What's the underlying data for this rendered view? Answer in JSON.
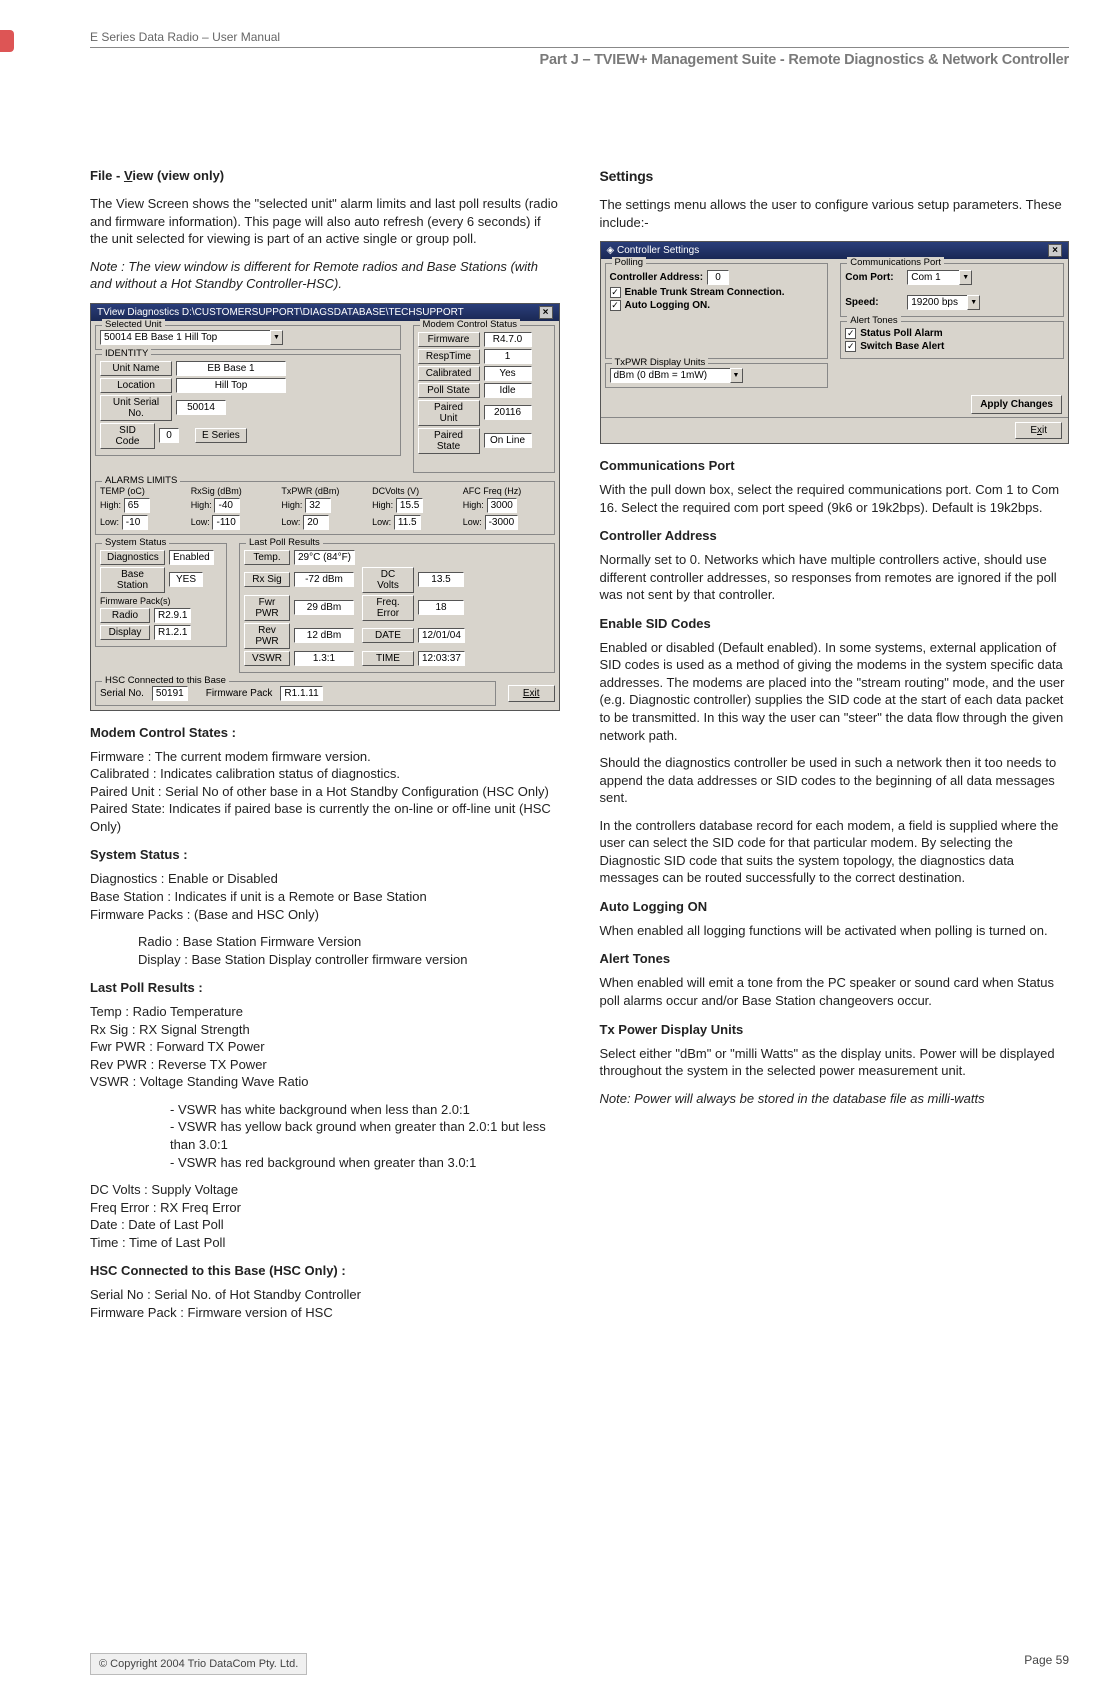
{
  "header": {
    "top": "E Series Data Radio – User Manual",
    "sub": "Part J – TVIEW+ Management Suite -  Remote Diagnostics & Network Controller"
  },
  "footer": {
    "copyright": "© Copyright 2004 Trio DataCom Pty. Ltd.",
    "page": "Page 59"
  },
  "col1": {
    "h1": "File - View (view only)",
    "p1": "The View Screen shows the \"selected unit\" alarm limits and last poll results (radio and firmware information). This page will also auto refresh (every 6 seconds) if the unit selected for viewing is part of an active single or group poll.",
    "note1": "Note : The view window is different for Remote radios and Base Stations (with and without a Hot Standby Controller-HSC).",
    "win1": {
      "title": "TView Diagnostics    D:\\CUSTOMERSUPPORT\\DIAGSDATABASE\\TECHSUPPORT",
      "selected_unit": {
        "label": "Selected Unit",
        "value": "50014 EB Base 1 Hill Top"
      },
      "identity": {
        "label": "IDENTITY",
        "unit_name_label": "Unit Name",
        "unit_name": "EB Base 1",
        "location_label": "Location",
        "location": "Hill Top",
        "serial_label": "Unit Serial No.",
        "serial": "50014",
        "sid_label": "SID Code",
        "sid": "0",
        "series_btn": "E Series"
      },
      "mcs": {
        "label": "Modem Control Status",
        "rows": [
          [
            "Firmware",
            "R4.7.0"
          ],
          [
            "RespTime",
            "1"
          ],
          [
            "Calibrated",
            "Yes"
          ],
          [
            "Poll State",
            "Idle"
          ],
          [
            "Paired Unit",
            "20116"
          ],
          [
            "Paired State",
            "On Line"
          ]
        ]
      },
      "alarms": {
        "label": "ALARMS LIMITS",
        "cols": [
          "TEMP (oC)",
          "RxSig (dBm)",
          "TxPWR (dBm)",
          "DCVolts (V)",
          "AFC Freq (Hz)"
        ],
        "high_label": "High:",
        "low_label": "Low:",
        "high": [
          "65",
          "-40",
          "32",
          "15.5",
          "3000"
        ],
        "low": [
          "-10",
          "-110",
          "20",
          "11.5",
          "-3000"
        ]
      },
      "sys": {
        "label": "System Status",
        "diag_label": "Diagnostics",
        "diag": "Enabled",
        "base_label": "Base Station",
        "base": "YES",
        "fw_label": "Firmware Pack(s)",
        "radio_label": "Radio",
        "radio": "R2.9.1",
        "disp_label": "Display",
        "disp": "R1.2.1"
      },
      "lpr": {
        "label": "Last Poll Results",
        "rows": [
          [
            "Temp.",
            "29°C   (84°F)",
            "",
            ""
          ],
          [
            "Rx Sig",
            "-72 dBm",
            "DC Volts",
            "13.5"
          ],
          [
            "Fwr PWR",
            "29 dBm",
            "Freq. Error",
            "18"
          ],
          [
            "Rev PWR",
            "12 dBm",
            "DATE",
            "12/01/04"
          ],
          [
            "VSWR",
            "1.3:1",
            "TIME",
            "12:03:37"
          ]
        ]
      },
      "hsc": {
        "label": "HSC Connected to this Base",
        "serial_label": "Serial No.",
        "serial": "50191",
        "fw_label": "Firmware Pack",
        "fw": "R1.1.11"
      },
      "exit": "Exit"
    },
    "h2": "Modem Control States :",
    "mcs_lines": [
      "Firmware : The current modem firmware version.",
      "Calibrated : Indicates calibration status of diagnostics.",
      "Paired Unit : Serial No of other base in a Hot Standby Configuration (HSC Only)",
      "Paired State: Indicates if paired base is currently the on-line or off-line unit (HSC Only)"
    ],
    "h3": "System Status :",
    "sys_lines": [
      "Diagnostics : Enable or Disabled",
      "Base Station : Indicates if unit is a Remote or Base Station",
      "Firmware Packs : (Base and HSC Only)"
    ],
    "sys_indent": [
      "Radio : Base Station Firmware Version",
      "Display : Base Station Display controller firmware version"
    ],
    "h4": "Last Poll Results :",
    "lpr_lines": [
      "Temp : Radio Temperature",
      "Rx Sig : RX Signal Strength",
      "Fwr PWR : Forward TX Power",
      "Rev PWR : Reverse TX Power",
      "VSWR : Voltage Standing Wave Ratio"
    ],
    "lpr_indent": [
      "- VSWR has white background when less than 2.0:1",
      "- VSWR has yellow back ground when greater than 2.0:1 but   less than 3.0:1",
      "- VSWR has red background when greater than 3.0:1"
    ],
    "lpr_lines2": [
      "DC Volts : Supply Voltage",
      "Freq Error : RX Freq Error",
      "Date : Date of Last Poll",
      "Time : Time of Last Poll"
    ],
    "h5": "HSC Connected to this Base (HSC Only) :",
    "hsc_lines": [
      "Serial No : Serial No. of Hot Standby Controller",
      "Firmware Pack : Firmware version of HSC"
    ]
  },
  "col2": {
    "h1": "Settings",
    "p1": "The settings menu allows the user to configure various setup parameters.  These include:-",
    "win2": {
      "title": "Controller Settings",
      "polling": {
        "label": "Polling",
        "addr_label": "Controller Address:",
        "addr": "0",
        "en_trunk": "Enable Trunk Stream Connection.",
        "auto_log": "Auto Logging ON."
      },
      "comm": {
        "label": "Communications Port",
        "port_label": "Com Port:",
        "port": "Com 1",
        "speed_label": "Speed:",
        "speed": "19200 bps"
      },
      "txp": {
        "label": "TxPWR Display Units",
        "value": "dBm (0 dBm = 1mW)"
      },
      "alert": {
        "label": "Alert Tones",
        "status": "Status Poll Alarm",
        "switch": "Switch Base Alert"
      },
      "apply": "Apply Changes",
      "exit": "Exit"
    },
    "h2": "Communications Port",
    "p2": "With the pull down box, select the required communications port. Com 1 to Com 16. Select the required com port speed (9k6 or 19k2bps). Default is 19k2bps.",
    "h3": "Controller Address",
    "p3": "Normally set to 0. Networks which have multiple controllers active, should use different controller addresses, so responses from remotes are ignored if the poll was not sent by that controller.",
    "h4": "Enable SID Codes",
    "p4": "Enabled or disabled (Default enabled).  In some systems, external application of SID codes is used as a method of giving the modems in the system specific data addresses.  The modems are placed into the \"stream routing\" mode, and the user (e.g. Diagnostic controller) supplies the SID code at the start of each data packet to be transmitted.  In this way the user can \"steer\" the data flow through the given network path.",
    "p5": "Should the diagnostics controller be used in such a network then it too needs to append the data addresses or SID codes to the beginning of all data messages sent.",
    "p6": "In the controllers database record for each modem, a field is supplied where the user can select the SID code for that particular modem.  By selecting the Diagnostic SID code that suits the system topology, the diagnostics data messages can be routed successfully to the correct destination.",
    "h5": "Auto Logging ON",
    "p7": "When enabled all logging functions will be activated when polling is turned on.",
    "h6": "Alert Tones",
    "p8": "When enabled will emit a tone from the PC speaker or sound card when Status poll alarms occur and/or Base Station changeovers occur.",
    "h7": "Tx Power Display Units",
    "p9": "Select either \"dBm\" or \"milli Watts\" as the display units.  Power will be displayed throughout the system in the selected power measurement unit.",
    "note2": "Note: Power will always be stored in the database file as milli-watts"
  }
}
